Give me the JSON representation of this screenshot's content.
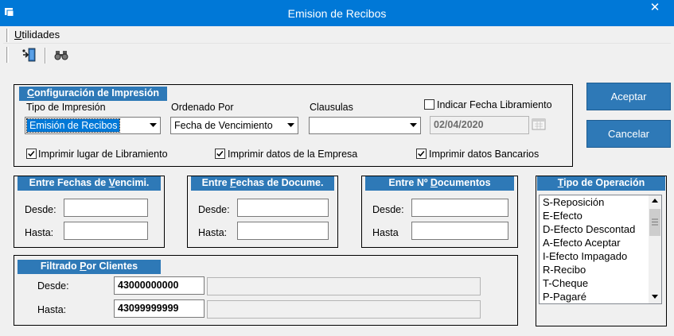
{
  "window": {
    "title": "Emision de Recibos",
    "close_glyph": "✕"
  },
  "menu": {
    "utilidades_first": "U",
    "utilidades_rest": "tilidades"
  },
  "config": {
    "title_pre": "C",
    "title_post": "onfiguración de Impresión",
    "tipo_label": "Tipo de Impresión",
    "tipo_value": "Emisión de Recibos",
    "orden_label": "Ordenado Por",
    "orden_value": "Fecha de Vencimiento",
    "clausulas_label": "Clausulas",
    "clausulas_value": "",
    "indicar_label": "Indicar Fecha Libramiento",
    "indicar_checked": false,
    "fecha_libramiento": "02/04/2020",
    "chk_lugar_label": "Imprimir lugar de Libramiento",
    "chk_lugar_checked": true,
    "chk_empresa_label": "Imprimir datos de la Empresa",
    "chk_empresa_checked": true,
    "chk_bancarios_label": "Imprimir datos Bancarios",
    "chk_bancarios_checked": true
  },
  "venc": {
    "title_pre": "Entre Fechas de ",
    "title_u": "V",
    "title_post": "encimi.",
    "desde_label": "Desde:",
    "hasta_label": "Hasta:",
    "desde_value": "",
    "hasta_value": ""
  },
  "docu": {
    "title_pre": "Entre ",
    "title_u": "F",
    "title_post": "echas de Docume.",
    "desde_label": "Desde:",
    "hasta_label": "Hasta:",
    "desde_value": "",
    "hasta_value": ""
  },
  "ndoc": {
    "title_pre": "Entre Nº ",
    "title_u": "D",
    "title_post": "ocumentos",
    "desde_label": "Desde:",
    "hasta_label": "Hasta",
    "desde_value": "",
    "hasta_value": ""
  },
  "clientes": {
    "title_pre": "Filtrado ",
    "title_u": "P",
    "title_post": "or Clientes",
    "desde_label": "Desde:",
    "hasta_label": "Hasta:",
    "desde_code": "43000000000",
    "hasta_code": "43099999999",
    "desde_name": "",
    "hasta_name": ""
  },
  "tipo_operacion": {
    "title_u": "T",
    "title_post": "ipo de Operación",
    "items": [
      "S-Reposición",
      "E-Efecto",
      "D-Efecto Descontad",
      "A-Efecto Aceptar",
      "I-Efecto Impagado",
      "R-Recibo",
      "T-Cheque",
      "P-Pagaré"
    ]
  },
  "buttons": {
    "accept": "Aceptar",
    "cancel": "Cancelar"
  },
  "colors": {
    "titlebar": "#0078d7",
    "group_header": "#2e79b7",
    "button": "#2e79b7",
    "background": "#f0f0f0"
  },
  "icons": [
    "window-app-icon",
    "close-icon",
    "exit-door-icon",
    "binoculars-icon",
    "calendar-icon",
    "dropdown-arrow-icon",
    "checkbox-check-icon",
    "scroll-up-icon",
    "scroll-down-icon"
  ]
}
